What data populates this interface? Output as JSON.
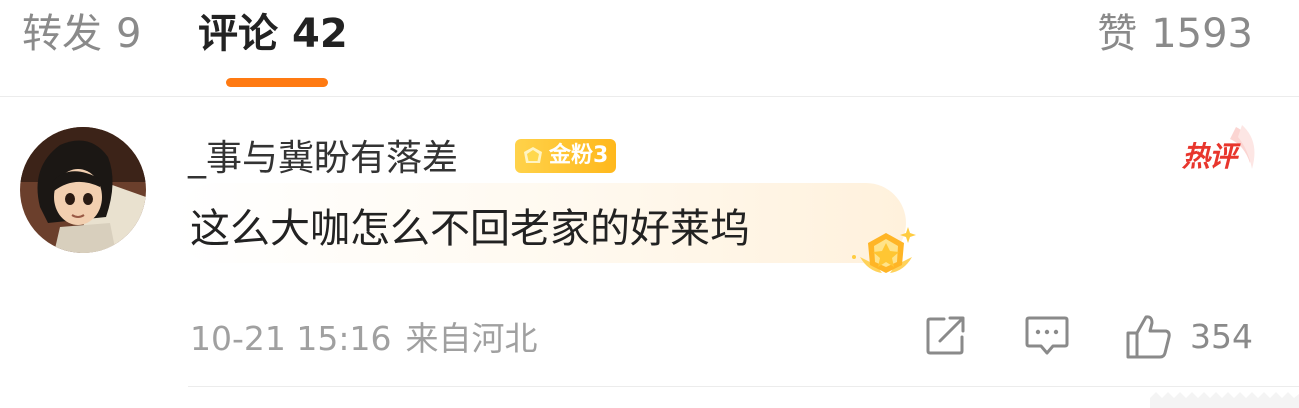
{
  "tabs": {
    "repost": {
      "label": "转发",
      "count": "9"
    },
    "comments": {
      "label": "评论",
      "count": "42"
    },
    "likes": {
      "label": "赞",
      "count": "1593"
    }
  },
  "colors": {
    "accent": "#ff7a12",
    "hot": "#e8362d",
    "badge": "#ffc233"
  },
  "comment": {
    "username": "_事与冀盼有落差",
    "badge_label": "金粉3",
    "hot_tag": "热评",
    "text": "这么大咖怎么不回老家的好莱坞",
    "date": "10-21 15:16",
    "location": "来自河北",
    "like_count": "354"
  },
  "icons": [
    "share-icon",
    "comment-icon",
    "thumb-up-icon",
    "crown-icon",
    "medal-icon"
  ]
}
